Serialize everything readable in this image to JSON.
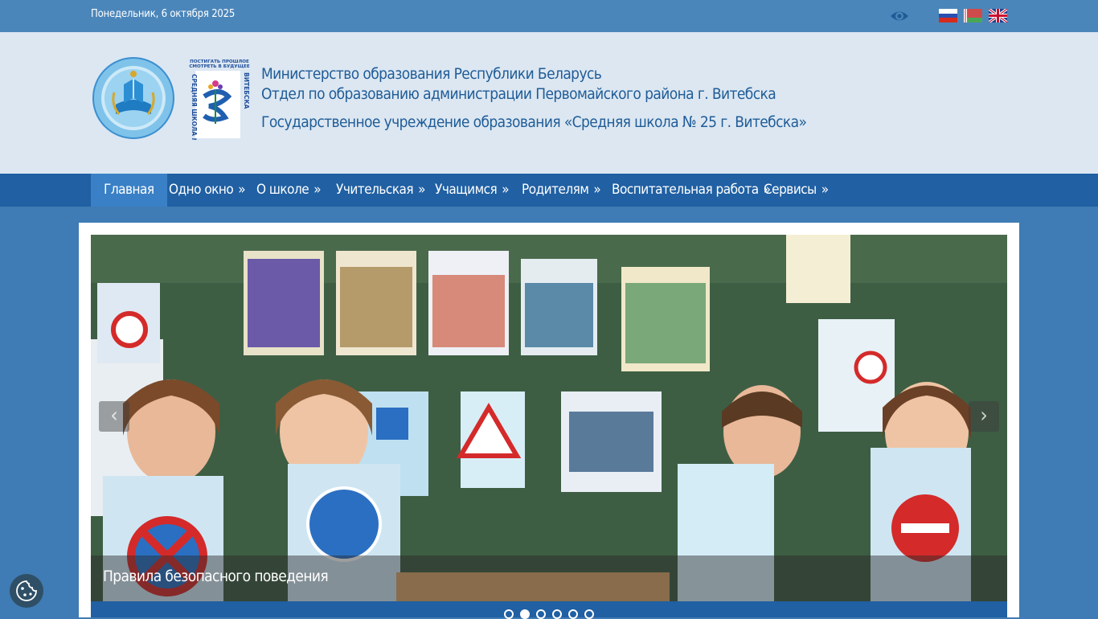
{
  "topbar": {
    "date": "Понедельник, 6 октября 2025",
    "accessibility_icon": "eye-icon",
    "languages": [
      "ru",
      "by",
      "en"
    ]
  },
  "header": {
    "line1": "Министерство образования Республики Беларусь",
    "line2": "Отдел по образованию администрации Первомайского района г. Витебска",
    "line3": "Государственное учреждение образования «Средняя школа № 25 г. Витебска»",
    "school_logo_text_top": "ПОСТИГАТЬ ПРОШЛОЕ СМОТРЕТЬ В БУДУЩЕЕ",
    "school_logo_text_side": "СРЕДНЯЯ ШКОЛА № 25 г. ВИТЕБСКА"
  },
  "nav": {
    "items": [
      {
        "label": "Главная",
        "arrow": ""
      },
      {
        "label": "Одно окно",
        "arrow": "»"
      },
      {
        "label": "О школе",
        "arrow": "»"
      },
      {
        "label": "Учительская",
        "arrow": "»"
      },
      {
        "label": "Учащимся",
        "arrow": "»"
      },
      {
        "label": "Родителям",
        "arrow": "»"
      },
      {
        "label": "Воспитательная работа",
        "arrow": "»"
      },
      {
        "label": "Сервисы",
        "arrow": "»"
      }
    ]
  },
  "slider": {
    "caption": "Правила безопасного поведения",
    "prev": "‹",
    "next": "›",
    "slide_count": 6,
    "active_slide": 2
  },
  "colors": {
    "topbar": "#4b86ba",
    "header_bg": "#dce7f2",
    "nav_bg": "#2060a3",
    "nav_active": "#3a80c6",
    "page_bg": "#3f7bb4",
    "heading_text": "#1f5c97"
  }
}
